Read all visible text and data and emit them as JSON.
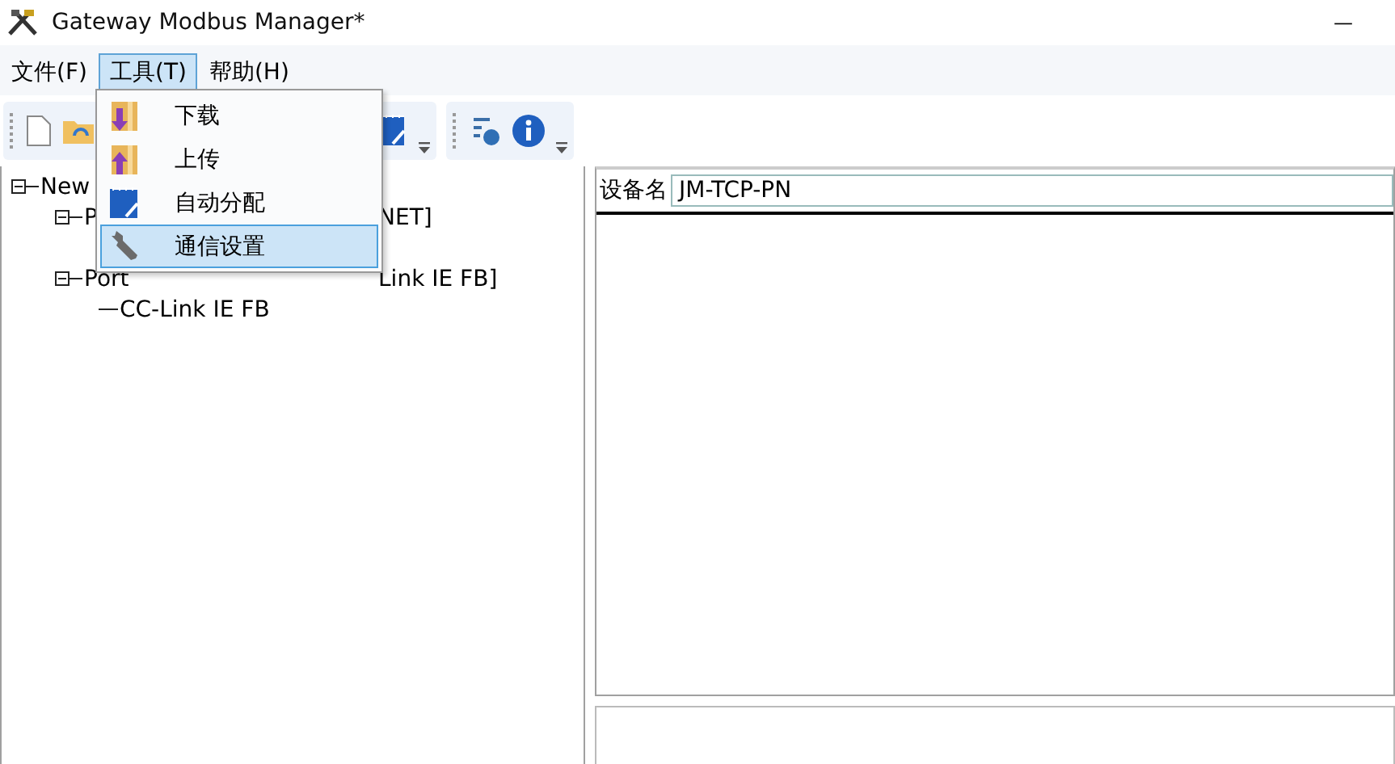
{
  "window": {
    "title": "Gateway Modbus Manager*",
    "minimize": "—"
  },
  "menubar": [
    {
      "label": "文件(F)",
      "selected": false
    },
    {
      "label": "工具(T)",
      "selected": true
    },
    {
      "label": "帮助(H)",
      "selected": false
    }
  ],
  "menu": [
    {
      "label": "下载",
      "selected": false
    },
    {
      "label": "上传",
      "selected": false
    },
    {
      "label": "自动分配",
      "selected": false
    },
    {
      "label": "通信设置",
      "selected": true
    }
  ],
  "tree": [
    {
      "label": "New",
      "children": [
        {
          "label": "P",
          "tail": "NET]",
          "expanded": true
        },
        {
          "label": "Port",
          "tail": "Link IE FB]",
          "expanded": true,
          "children": [
            {
              "label": "CC-Link IE FB"
            }
          ]
        }
      ]
    }
  ],
  "device": {
    "label": "设备名",
    "value": "JM-TCP-PN"
  }
}
